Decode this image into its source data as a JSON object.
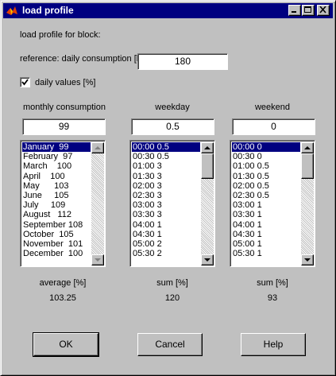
{
  "window": {
    "title": "load profile",
    "icon": "matlab-icon",
    "buttons": [
      "minimize-icon",
      "maximize-icon",
      "close-icon"
    ]
  },
  "header": {
    "block_label": "load profile for block:",
    "reference_label": "reference: daily consumption [l]",
    "reference_value": "180",
    "daily_values_label": "daily values [%]",
    "daily_values_checked": true
  },
  "columns": {
    "monthly": {
      "title": "monthly consumption",
      "input_value": "99",
      "items": [
        "January  99",
        "February  97",
        "March    100",
        "April    100",
        "May      103",
        "June     105",
        "July     109",
        "August   112",
        "September 108",
        "October  105",
        "November  101",
        "December  100"
      ],
      "selected_index": 0,
      "stat_label": "average [%]",
      "stat_value": "103.25"
    },
    "weekday": {
      "title": "weekday",
      "input_value": "0.5",
      "items": [
        "00:00 0.5",
        "00:30 0.5",
        "01:00 3",
        "01:30 3",
        "02:00 3",
        "02:30 3",
        "03:00 3",
        "03:30 3",
        "04:00 1",
        "04:30 1",
        "05:00 2",
        "05:30 2"
      ],
      "selected_index": 0,
      "stat_label": "sum [%]",
      "stat_value": "120"
    },
    "weekend": {
      "title": "weekend",
      "input_value": "0",
      "items": [
        "00:00 0",
        "00:30 0",
        "01:00 0.5",
        "01:30 0.5",
        "02:00 0.5",
        "02:30 0.5",
        "03:00 1",
        "03:30 1",
        "04:00 1",
        "04:30 1",
        "05:00 1",
        "05:30 1"
      ],
      "selected_index": 0,
      "stat_label": "sum [%]",
      "stat_value": "93"
    }
  },
  "footer": {
    "ok_label": "OK",
    "cancel_label": "Cancel",
    "help_label": "Help"
  },
  "colors": {
    "titlebar": "#000080",
    "face": "#c0c0c0",
    "selection": "#000080"
  }
}
